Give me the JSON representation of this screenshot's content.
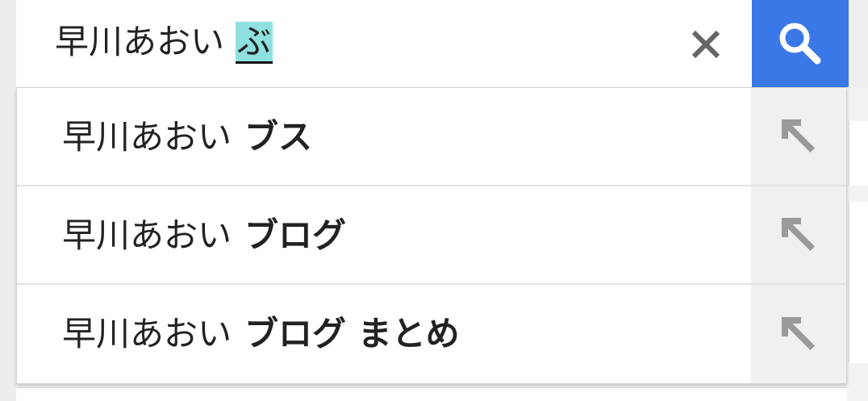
{
  "search": {
    "query_prefix": "早川あおい",
    "composing_text": "ぶ",
    "clear_icon": "close-icon",
    "search_icon": "search-icon",
    "accent_color": "#3b78e7"
  },
  "suggestions": [
    {
      "prefix": "早川あおい",
      "completion": "ブス",
      "action_icon": "arrow-up-left-icon"
    },
    {
      "prefix": "早川あおい",
      "completion": "ブログ",
      "action_icon": "arrow-up-left-icon"
    },
    {
      "prefix": "早川あおい",
      "completion": "ブログ まとめ",
      "action_icon": "arrow-up-left-icon"
    }
  ]
}
